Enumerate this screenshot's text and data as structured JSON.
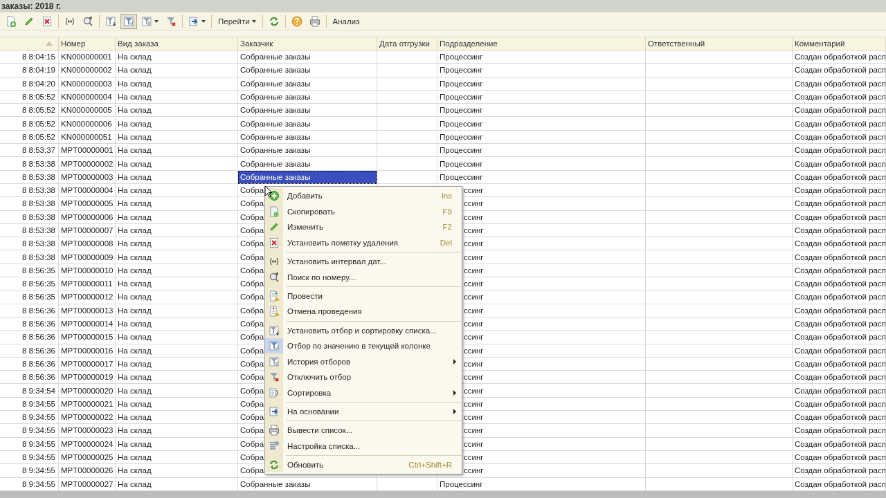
{
  "window": {
    "title": "заказы: 2018 г."
  },
  "toolbar": [
    {
      "kind": "icon",
      "pressed": false
    },
    {
      "kind": "icon",
      "pressed": false
    },
    {
      "kind": "icon",
      "pressed": false
    },
    {
      "kind": "separator"
    },
    {
      "kind": "icon",
      "pressed": false
    },
    {
      "kind": "icon",
      "pressed": false
    },
    {
      "kind": "separator"
    },
    {
      "kind": "icon",
      "pressed": false
    },
    {
      "kind": "icon",
      "pressed": true
    },
    {
      "kind": "icon_dropdown",
      "pressed": false
    },
    {
      "kind": "icon",
      "pressed": false
    },
    {
      "kind": "separator"
    },
    {
      "kind": "icon_dropdown",
      "pressed": false
    },
    {
      "kind": "separator"
    },
    {
      "kind": "text_dropdown",
      "label": "Перейти"
    },
    {
      "kind": "separator"
    },
    {
      "kind": "icon",
      "pressed": false
    },
    {
      "kind": "separator"
    },
    {
      "kind": "icon",
      "pressed": false
    },
    {
      "kind": "icon",
      "pressed": false
    },
    {
      "kind": "separator"
    },
    {
      "kind": "text",
      "label": "Анализ"
    }
  ],
  "table": {
    "columns": [
      {
        "sorted": true,
        "current": false
      },
      {
        "label": "Номер",
        "current": false
      },
      {
        "label": "Вид заказа",
        "current": false
      },
      {
        "label": "Заказчик",
        "current": true
      },
      {
        "label": "Дата отгрузки",
        "current": false
      },
      {
        "label": "Подразделение",
        "current": false
      },
      {
        "label": "Ответственный",
        "current": false
      },
      {
        "label": "Комментарий",
        "current": false
      }
    ],
    "rows": [
      {
        "selected": false,
        "under_menu": false,
        "cells": [
          "8 8:04:15",
          "KN000000001",
          "На склад",
          "Собранные заказы",
          "",
          "Процессинг",
          "",
          "Создан обработкой расп"
        ]
      },
      {
        "selected": false,
        "under_menu": false,
        "cells": [
          "8 8:04:19",
          "KN000000002",
          "На склад",
          "Собранные заказы",
          "",
          "Процессинг",
          "",
          "Создан обработкой расп"
        ]
      },
      {
        "selected": false,
        "under_menu": false,
        "cells": [
          "8 8:04:20",
          "KN000000003",
          "На склад",
          "Собранные заказы",
          "",
          "Процессинг",
          "",
          "Создан обработкой расп"
        ]
      },
      {
        "selected": false,
        "under_menu": false,
        "cells": [
          "8 8:05:52",
          "KN000000004",
          "На склад",
          "Собранные заказы",
          "",
          "Процессинг",
          "",
          "Создан обработкой расп"
        ]
      },
      {
        "selected": false,
        "under_menu": false,
        "cells": [
          "8 8:05:52",
          "KN000000005",
          "На склад",
          "Собранные заказы",
          "",
          "Процессинг",
          "",
          "Создан обработкой расп"
        ]
      },
      {
        "selected": false,
        "under_menu": false,
        "cells": [
          "8 8:05:52",
          "KN000000006",
          "На склад",
          "Собранные заказы",
          "",
          "Процессинг",
          "",
          "Создан обработкой расп"
        ]
      },
      {
        "selected": false,
        "under_menu": false,
        "cells": [
          "8 8:05:52",
          "KN000000051",
          "На склад",
          "Собранные заказы",
          "",
          "Процессинг",
          "",
          "Создан обработкой расп"
        ]
      },
      {
        "selected": false,
        "under_menu": false,
        "cells": [
          "8 8:53:37",
          "MPT00000001",
          "На склад",
          "Собранные заказы",
          "",
          "Процессинг",
          "",
          "Создан обработкой расп"
        ]
      },
      {
        "selected": false,
        "under_menu": false,
        "cells": [
          "8 8:53:38",
          "MPT00000002",
          "На склад",
          "Собранные заказы",
          "",
          "Процессинг",
          "",
          "Создан обработкой расп"
        ]
      },
      {
        "selected": true,
        "under_menu": false,
        "cells": [
          "8 8:53:38",
          "MPT00000003",
          "На склад",
          "Собранные заказы",
          "",
          "Процессинг",
          "",
          "Создан обработкой расп"
        ]
      },
      {
        "selected": false,
        "under_menu": true,
        "cells": [
          "8 8:53:38",
          "MPT00000004",
          "На склад",
          "Собра",
          "",
          "ссинг",
          "",
          "Создан обработкой расп"
        ]
      },
      {
        "selected": false,
        "under_menu": true,
        "cells": [
          "8 8:53:38",
          "MPT00000005",
          "На склад",
          "Собра",
          "",
          "ссинг",
          "",
          "Создан обработкой расп"
        ]
      },
      {
        "selected": false,
        "under_menu": true,
        "cells": [
          "8 8:53:38",
          "MPT00000006",
          "На склад",
          "Собра",
          "",
          "ссинг",
          "",
          "Создан обработкой расп"
        ]
      },
      {
        "selected": false,
        "under_menu": true,
        "cells": [
          "8 8:53:38",
          "MPT00000007",
          "На склад",
          "Собра",
          "",
          "ссинг",
          "",
          "Создан обработкой расп"
        ]
      },
      {
        "selected": false,
        "under_menu": true,
        "cells": [
          "8 8:53:38",
          "MPT00000008",
          "На склад",
          "Собра",
          "",
          "ссинг",
          "",
          "Создан обработкой расп"
        ]
      },
      {
        "selected": false,
        "under_menu": true,
        "cells": [
          "8 8:53:38",
          "MPT00000009",
          "На склад",
          "Собра",
          "",
          "ссинг",
          "",
          "Создан обработкой расп"
        ]
      },
      {
        "selected": false,
        "under_menu": true,
        "cells": [
          "8 8:56:35",
          "MPT00000010",
          "На склад",
          "Собра",
          "",
          "ссинг",
          "",
          "Создан обработкой расп"
        ]
      },
      {
        "selected": false,
        "under_menu": true,
        "cells": [
          "8 8:56:35",
          "MPT00000011",
          "На склад",
          "Собра",
          "",
          "ссинг",
          "",
          "Создан обработкой расп"
        ]
      },
      {
        "selected": false,
        "under_menu": true,
        "cells": [
          "8 8:56:35",
          "MPT00000012",
          "На склад",
          "Собра",
          "",
          "ссинг",
          "",
          "Создан обработкой расп"
        ]
      },
      {
        "selected": false,
        "under_menu": true,
        "cells": [
          "8 8:56:36",
          "MPT00000013",
          "На склад",
          "Собра",
          "",
          "ссинг",
          "",
          "Создан обработкой расп"
        ]
      },
      {
        "selected": false,
        "under_menu": true,
        "cells": [
          "8 8:56:36",
          "MPT00000014",
          "На склад",
          "Собра",
          "",
          "ссинг",
          "",
          "Создан обработкой расп"
        ]
      },
      {
        "selected": false,
        "under_menu": true,
        "cells": [
          "8 8:56:36",
          "MPT00000015",
          "На склад",
          "Собра",
          "",
          "ссинг",
          "",
          "Создан обработкой расп"
        ]
      },
      {
        "selected": false,
        "under_menu": true,
        "cells": [
          "8 8:56:36",
          "MPT00000016",
          "На склад",
          "Собра",
          "",
          "ссинг",
          "",
          "Создан обработкой расп"
        ]
      },
      {
        "selected": false,
        "under_menu": true,
        "cells": [
          "8 8:56:36",
          "MPT00000017",
          "На склад",
          "Собра",
          "",
          "ссинг",
          "",
          "Создан обработкой расп"
        ]
      },
      {
        "selected": false,
        "under_menu": true,
        "cells": [
          "8 8:56:36",
          "MPT00000019",
          "На склад",
          "Собра",
          "",
          "ссинг",
          "",
          "Создан обработкой расп"
        ]
      },
      {
        "selected": false,
        "under_menu": true,
        "cells": [
          "8 9:34:54",
          "MPT00000020",
          "На склад",
          "Собра",
          "",
          "ссинг",
          "",
          "Создан обработкой расп"
        ]
      },
      {
        "selected": false,
        "under_menu": true,
        "cells": [
          "8 9:34:55",
          "MPT00000021",
          "На склад",
          "Собра",
          "",
          "ссинг",
          "",
          "Создан обработкой расп"
        ]
      },
      {
        "selected": false,
        "under_menu": true,
        "cells": [
          "8 9:34:55",
          "MPT00000022",
          "На склад",
          "Собра",
          "",
          "ссинг",
          "",
          "Создан обработкой расп"
        ]
      },
      {
        "selected": false,
        "under_menu": true,
        "cells": [
          "8 9:34:55",
          "MPT00000023",
          "На склад",
          "Собра",
          "",
          "ссинг",
          "",
          "Создан обработкой расп"
        ]
      },
      {
        "selected": false,
        "under_menu": true,
        "cells": [
          "8 9:34:55",
          "MPT00000024",
          "На склад",
          "Собра",
          "",
          "ссинг",
          "",
          "Создан обработкой расп"
        ]
      },
      {
        "selected": false,
        "under_menu": true,
        "cells": [
          "8 9:34:55",
          "MPT00000025",
          "На склад",
          "Собра",
          "",
          "ссинг",
          "",
          "Создан обработкой расп"
        ]
      },
      {
        "selected": false,
        "under_menu": true,
        "cells": [
          "8 9:34:55",
          "MPT00000026",
          "На склад",
          "Собра",
          "",
          "ссинг",
          "",
          "Создан обработкой расп"
        ]
      },
      {
        "selected": false,
        "under_menu": false,
        "cells": [
          "8 9:34:55",
          "MPT00000027",
          "На склад",
          "Собранные заказы",
          "",
          "Процессинг",
          "",
          "Создан обработкой расп"
        ]
      }
    ]
  },
  "context_menu": {
    "items": [
      {
        "label": "Добавить",
        "shortcut": "Ins",
        "submenu": false,
        "separator_before": false,
        "highlighted_icon": false
      },
      {
        "label": "Скопировать",
        "shortcut": "F9",
        "submenu": false,
        "separator_before": false,
        "highlighted_icon": false
      },
      {
        "label": "Изменить",
        "shortcut": "F2",
        "submenu": false,
        "separator_before": false,
        "highlighted_icon": false
      },
      {
        "label": "Установить пометку удаления",
        "shortcut": "Del",
        "submenu": false,
        "separator_before": false,
        "highlighted_icon": false
      },
      {
        "label": "Установить интервал дат...",
        "submenu": false,
        "separator_before": true,
        "highlighted_icon": false
      },
      {
        "label": "Поиск по номеру...",
        "submenu": false,
        "separator_before": false,
        "highlighted_icon": false
      },
      {
        "label": "Провести",
        "submenu": false,
        "separator_before": true,
        "highlighted_icon": false
      },
      {
        "label": "Отмена проведения",
        "submenu": false,
        "separator_before": false,
        "highlighted_icon": false
      },
      {
        "label": "Установить отбор и сортировку списка...",
        "submenu": false,
        "separator_before": true,
        "highlighted_icon": false
      },
      {
        "label": "Отбор по значению в текущей колонке",
        "submenu": false,
        "separator_before": false,
        "highlighted_icon": true
      },
      {
        "label": "История отборов",
        "submenu": true,
        "separator_before": false,
        "highlighted_icon": false
      },
      {
        "label": "Отключить отбор",
        "submenu": false,
        "separator_before": false,
        "highlighted_icon": false
      },
      {
        "label": "Сортировка",
        "submenu": true,
        "separator_before": false,
        "highlighted_icon": false
      },
      {
        "label": "На основании",
        "submenu": true,
        "separator_before": true,
        "highlighted_icon": false
      },
      {
        "label": "Вывести список...",
        "submenu": false,
        "separator_before": true,
        "highlighted_icon": false
      },
      {
        "label": "Настройка списка...",
        "submenu": false,
        "separator_before": false,
        "highlighted_icon": false
      },
      {
        "label": "Обновить",
        "shortcut": "Ctrl+Shift+R",
        "submenu": false,
        "separator_before": true,
        "highlighted_icon": false
      }
    ]
  }
}
